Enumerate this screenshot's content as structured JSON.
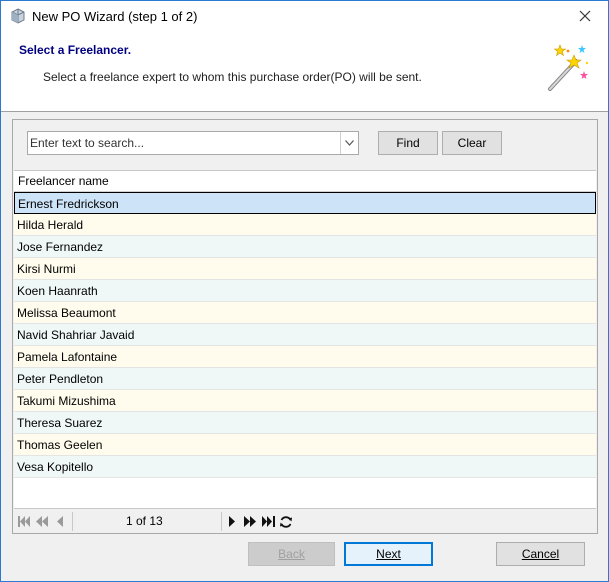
{
  "window": {
    "title": "New PO Wizard  (step 1 of 2)"
  },
  "header": {
    "title": "Select a Freelancer.",
    "description": "Select a freelance expert to whom this purchase order(PO) will be sent."
  },
  "search": {
    "placeholder": "Enter text to search...",
    "value": ""
  },
  "buttons": {
    "find": "Find",
    "clear": "Clear",
    "back": "Back",
    "next": "Next",
    "cancel": "Cancel"
  },
  "grid": {
    "column": "Freelancer name",
    "rows": [
      "Ernest Fredrickson",
      "Hilda Herald",
      "Jose Fernandez",
      "Kirsi Nurmi",
      "Koen Haanrath",
      "Melissa Beaumont",
      "Navid Shahriar Javaid",
      "Pamela Lafontaine",
      "Peter Pendleton",
      "Takumi Mizushima",
      "Theresa Suarez",
      "Thomas Geelen",
      "Vesa Kopitello"
    ],
    "selected_index": 0,
    "row_colors": [
      "#eff7f7",
      "#fffcee"
    ],
    "selected_color": "#cde3f7"
  },
  "pager": {
    "text": "1 of 13"
  },
  "colors": {
    "header_title": "#000080",
    "border_accent": "#2b79d0"
  }
}
